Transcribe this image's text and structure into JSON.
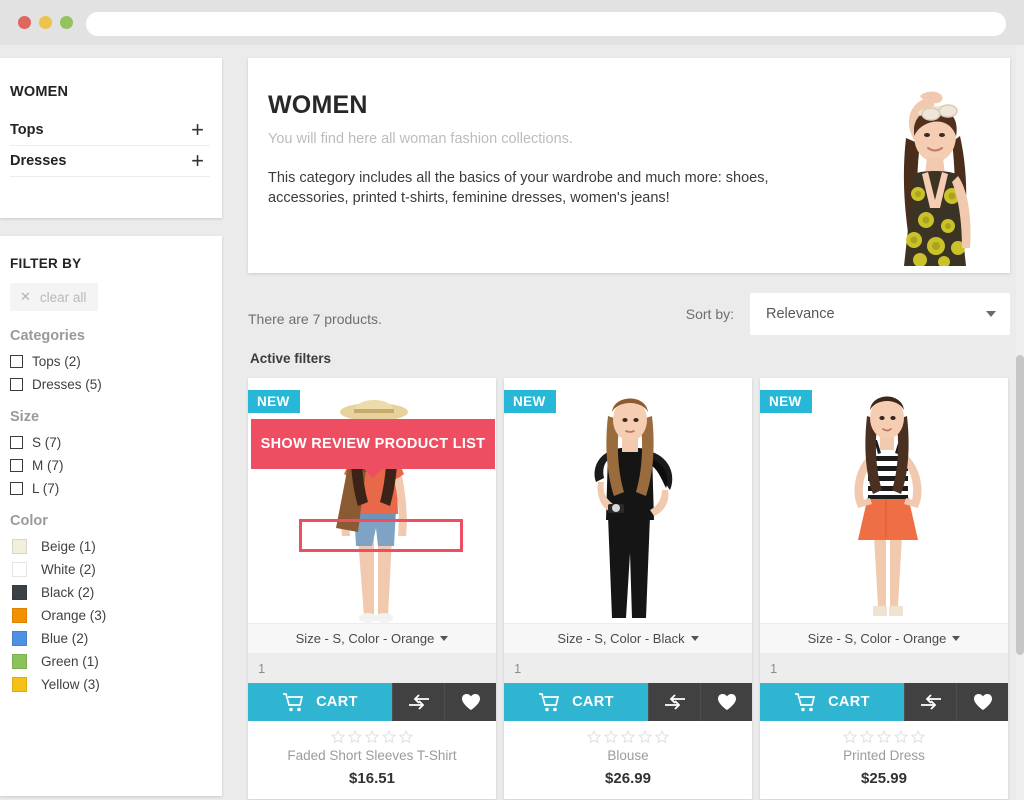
{
  "browser": {
    "url_value": "",
    "url_placeholder": "",
    "dots": [
      "close-red",
      "minimize-yellow",
      "maximize-green"
    ]
  },
  "sidebar": {
    "category_nav": {
      "title": "WOMEN",
      "items": [
        {
          "label": "Tops",
          "expand_icon": "plus-icon"
        },
        {
          "label": "Dresses",
          "expand_icon": "plus-icon"
        }
      ]
    },
    "filter": {
      "title": "FILTER BY",
      "clear_all_label": "clear all",
      "clear_all_icon": "close-x-icon",
      "groups": [
        {
          "name": "Categories",
          "options": [
            {
              "label": "Tops (2)"
            },
            {
              "label": "Dresses (5)"
            }
          ]
        },
        {
          "name": "Size",
          "options": [
            {
              "label": "S (7)"
            },
            {
              "label": "M (7)"
            },
            {
              "label": "L (7)"
            }
          ]
        },
        {
          "name": "Color",
          "options": [
            {
              "label": "Beige (1)",
              "swatch": "#f2f0dd"
            },
            {
              "label": "White (2)",
              "swatch": "#ffffff"
            },
            {
              "label": "Black (2)",
              "swatch": "#3b4149"
            },
            {
              "label": "Orange (3)",
              "swatch": "#f39200"
            },
            {
              "label": "Blue (2)",
              "swatch": "#4e90e2"
            },
            {
              "label": "Green (1)",
              "swatch": "#8bc35a"
            },
            {
              "label": "Yellow (3)",
              "swatch": "#f6c016"
            }
          ]
        }
      ]
    }
  },
  "banner": {
    "title": "WOMEN",
    "subtitle": "You will find here all woman fashion collections.",
    "description": "This category includes all the basics of your wardrobe and much more: shoes, accessories, printed t-shirts, feminine dresses, women's jeans!",
    "photo_alt": "woman-in-yellow-floral-dress"
  },
  "toolbar": {
    "product_count": "There are 7 products.",
    "sort_label": "Sort by:",
    "sort_value": "Relevance",
    "sort_caret_icon": "chevron-down-icon",
    "active_filters_label": "Active filters"
  },
  "tooltip": {
    "text": "SHOW REVIEW PRODUCT LIST",
    "color": "#ee4e62"
  },
  "theme": {
    "accent_cyan": "#2fb5d2",
    "badge_cyan": "#28b7d6",
    "dark_button": "#414141",
    "highlight_pink": "#ee4e62"
  },
  "products": [
    {
      "badge": "NEW",
      "variant": "Size - S, Color - Orange",
      "quantity": "1",
      "cart_label": "CART",
      "cart_icon": "shopping-cart-icon",
      "compare_icon": "compare-arrows-icon",
      "wishlist_icon": "heart-icon",
      "rating": 0,
      "rating_max": 5,
      "name": "Faded Short Sleeves T-Shirt",
      "price": "$16.51",
      "image_alt": "woman-in-orange-top-and-denim-shorts"
    },
    {
      "badge": "NEW",
      "variant": "Size - S, Color - Black",
      "quantity": "1",
      "cart_label": "CART",
      "cart_icon": "shopping-cart-icon",
      "compare_icon": "compare-arrows-icon",
      "wishlist_icon": "heart-icon",
      "rating": 0,
      "rating_max": 5,
      "name": "Blouse",
      "price": "$26.99",
      "image_alt": "woman-in-black-ruffle-blouse"
    },
    {
      "badge": "NEW",
      "variant": "Size - S, Color - Orange",
      "quantity": "1",
      "cart_label": "CART",
      "cart_icon": "shopping-cart-icon",
      "compare_icon": "compare-arrows-icon",
      "wishlist_icon": "heart-icon",
      "rating": 0,
      "rating_max": 5,
      "name": "Printed Dress",
      "price": "$25.99",
      "image_alt": "woman-in-striped-top-and-orange-skirt"
    }
  ]
}
